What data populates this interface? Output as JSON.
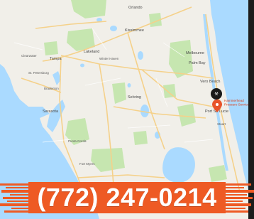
{
  "map": {
    "cities": [
      {
        "name": "Orlando",
        "cls": "city"
      },
      {
        "name": "Tampa",
        "cls": "city"
      },
      {
        "name": "Lakeland",
        "cls": "city"
      },
      {
        "name": "Kissimmee",
        "cls": "city"
      },
      {
        "name": "Melbourne",
        "cls": "city"
      },
      {
        "name": "Sebring",
        "cls": "city"
      },
      {
        "name": "Port St. Lucie",
        "cls": "city"
      },
      {
        "name": "Sarasota",
        "cls": "city"
      },
      {
        "name": "Palm Bay",
        "cls": "city"
      },
      {
        "name": "Vero Beach",
        "cls": "city"
      },
      {
        "name": "Clearwater",
        "cls": "city-sm"
      },
      {
        "name": "St. Petersburg",
        "cls": "city-sm"
      },
      {
        "name": "Bradenton",
        "cls": "city-sm"
      },
      {
        "name": "Winter Haven",
        "cls": "city-sm"
      },
      {
        "name": "Punta Gorda",
        "cls": "city-sm"
      },
      {
        "name": "Fort Myers",
        "cls": "city-sm"
      },
      {
        "name": "Stuart",
        "cls": "city-sm"
      }
    ],
    "marker_label": [
      "Hammerhead",
      "Pressure Services"
    ],
    "colors": {
      "water": "#aadaff",
      "land": "#f1efe9",
      "park": "#c6e6b0",
      "road": "#f5d18a",
      "marker": "#e8532a"
    },
    "marker_icon": "map-pin-icon"
  },
  "banner": {
    "phone": "(772) 247-0214",
    "color": "#ee5a24"
  }
}
